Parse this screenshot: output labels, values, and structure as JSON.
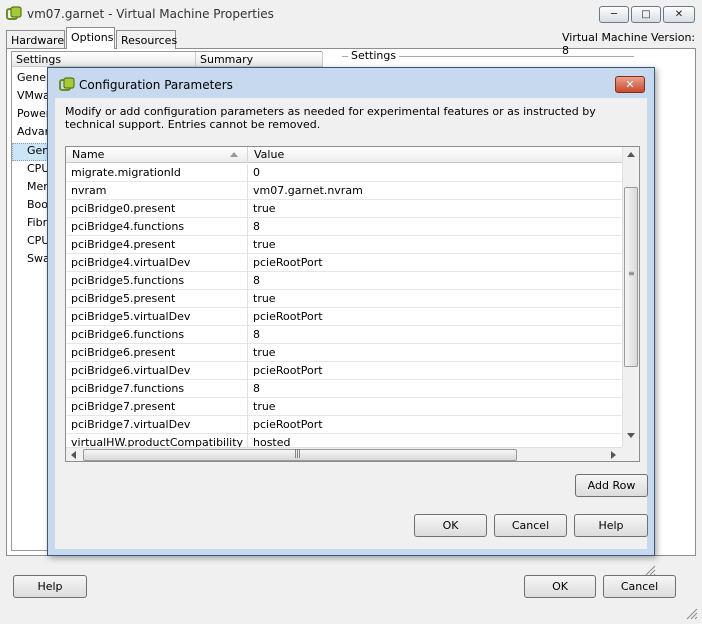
{
  "window": {
    "title": "vm07.garnet - Virtual Machine Properties",
    "min_glyph": "─",
    "max_glyph": "□",
    "close_glyph": "✕"
  },
  "tabs": [
    {
      "label": "Hardware"
    },
    {
      "label": "Options"
    },
    {
      "label": "Resources"
    }
  ],
  "vm_version": "Virtual Machine Version: 8",
  "settings_list": {
    "header_settings": "Settings",
    "header_summary": "Summary",
    "items": [
      "Gener",
      "VMwa",
      "Power",
      "Advan",
      "Gen",
      "CPU",
      "Men",
      "Boo",
      "Fibr",
      "CPU",
      "Swa"
    ]
  },
  "right_group_label": "Settings",
  "footer": {
    "help": "Help",
    "ok": "OK",
    "cancel": "Cancel"
  },
  "dialog": {
    "title": "Configuration Parameters",
    "close_glyph": "✕",
    "description": "Modify or add configuration parameters as needed for experimental features or as instructed by technical support. Entries cannot be removed.",
    "columns": {
      "name": "Name",
      "value": "Value"
    },
    "rows": [
      {
        "name": "migrate.migrationId",
        "value": "0"
      },
      {
        "name": "nvram",
        "value": "vm07.garnet.nvram"
      },
      {
        "name": "pciBridge0.present",
        "value": "true"
      },
      {
        "name": "pciBridge4.functions",
        "value": "8"
      },
      {
        "name": "pciBridge4.present",
        "value": "true"
      },
      {
        "name": "pciBridge4.virtualDev",
        "value": "pcieRootPort"
      },
      {
        "name": "pciBridge5.functions",
        "value": "8"
      },
      {
        "name": "pciBridge5.present",
        "value": "true"
      },
      {
        "name": "pciBridge5.virtualDev",
        "value": "pcieRootPort"
      },
      {
        "name": "pciBridge6.functions",
        "value": "8"
      },
      {
        "name": "pciBridge6.present",
        "value": "true"
      },
      {
        "name": "pciBridge6.virtualDev",
        "value": "pcieRootPort"
      },
      {
        "name": "pciBridge7.functions",
        "value": "8"
      },
      {
        "name": "pciBridge7.present",
        "value": "true"
      },
      {
        "name": "pciBridge7.virtualDev",
        "value": "pcieRootPort"
      },
      {
        "name": "virtualHW.productCompatibility",
        "value": "hosted"
      }
    ],
    "add_row": "Add Row",
    "ok": "OK",
    "cancel": "Cancel",
    "help": "Help",
    "vscroll_grip": "≡",
    "hscroll_grip": "|||"
  },
  "colors": {
    "dialog_frame": "#c7d9ee",
    "selection": "#cde6f7",
    "close_red": "#c94a2c"
  }
}
